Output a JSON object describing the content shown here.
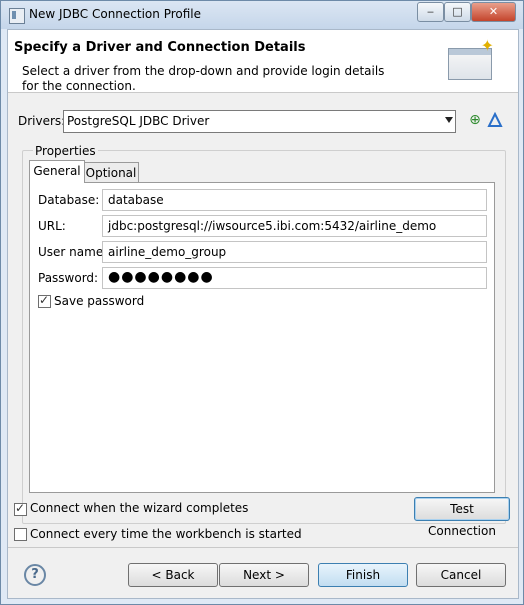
{
  "window": {
    "title": "New JDBC Connection Profile",
    "controls": {
      "minimize": "‒",
      "maximize": "□",
      "close": "✕"
    }
  },
  "header": {
    "title": "Specify a Driver and Connection Details",
    "description": "Select a driver from the drop-down and provide login details for the connection."
  },
  "drivers": {
    "label": "Drivers:",
    "selected": "PostgreSQL JDBC Driver",
    "new_icon": "new-driver-icon",
    "edit_icon": "edit-driver-icon"
  },
  "properties": {
    "legend": "Properties",
    "tabs": [
      "General",
      "Optional"
    ],
    "active_tab": "General",
    "fields": {
      "database": {
        "label": "Database:",
        "value": "database"
      },
      "url": {
        "label": "URL:",
        "value": "jdbc:postgresql://iwsource5.ibi.com:5432/airline_demo"
      },
      "username": {
        "label": "User name:",
        "value": "airline_demo_group"
      },
      "password": {
        "label": "Password:",
        "value": "●●●●●●●●"
      }
    },
    "save_password": {
      "label": "Save password",
      "checked": true
    }
  },
  "options": {
    "connect_when_completes": {
      "label": "Connect when the wizard completes",
      "checked": true
    },
    "connect_every_time": {
      "label": "Connect every time the workbench is started",
      "checked": false
    },
    "test_connection": "Test Connection"
  },
  "footer": {
    "help_icon": "help-icon",
    "help_glyph": "?",
    "back": "< Back",
    "next": "Next >",
    "finish": "Finish",
    "cancel": "Cancel"
  },
  "colors": {
    "window_frame": "#dfe9f5",
    "dialog_bg": "#f0f0f0",
    "primary_button": "#c2ddf1"
  }
}
